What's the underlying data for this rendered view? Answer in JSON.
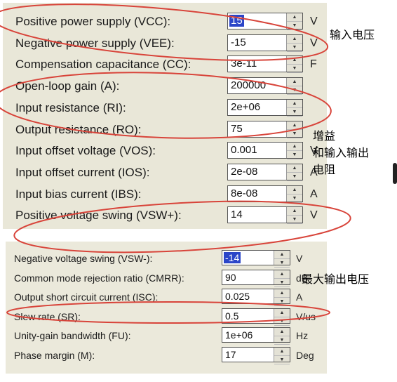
{
  "panel_top": {
    "rows": [
      {
        "label": "Positive power supply (VCC):",
        "value": "15",
        "unit": "V",
        "selected": true
      },
      {
        "label": "Negative power supply (VEE):",
        "value": "-15",
        "unit": "V"
      },
      {
        "label": "Compensation capacitance (CC):",
        "value": "3e-11",
        "unit": "F"
      },
      {
        "label": "Open-loop gain (A):",
        "value": "200000",
        "unit": ""
      },
      {
        "label": "Input resistance (RI):",
        "value": "2e+06",
        "unit": ""
      },
      {
        "label": "Output resistance (RO):",
        "value": "75",
        "unit": ""
      },
      {
        "label": "Input offset voltage (VOS):",
        "value": "0.001",
        "unit": "V"
      },
      {
        "label": "Input offset current (IOS):",
        "value": "2e-08",
        "unit": "A"
      },
      {
        "label": "Input bias current (IBS):",
        "value": "8e-08",
        "unit": "A"
      },
      {
        "label": "Positive voltage swing (VSW+):",
        "value": "14",
        "unit": "V"
      }
    ]
  },
  "panel_bottom": {
    "rows": [
      {
        "label": "Negative voltage swing (VSW-):",
        "value": "-14",
        "unit": "V",
        "selected": true
      },
      {
        "label": "Common mode rejection ratio (CMRR):",
        "value": "90",
        "unit": "dB"
      },
      {
        "label": "Output short circuit current (ISC):",
        "value": "0.025",
        "unit": "A"
      },
      {
        "label": "Slew rate (SR):",
        "value": "0.5",
        "unit": "V/us"
      },
      {
        "label": "Unity-gain bandwidth (FU):",
        "value": "1e+06",
        "unit": "Hz"
      },
      {
        "label": "Phase margin (M):",
        "value": "17",
        "unit": "Deg"
      }
    ]
  },
  "annotations": {
    "input_voltage": "输入电压",
    "gain_line1": "增益",
    "gain_line2": "和输入输出",
    "gain_line3": "电阻",
    "max_output": "最大输出电压"
  },
  "colors": {
    "annotation_ellipse": "#d8443a",
    "panel_bg": "#e9e7d8",
    "selection": "#2b45c8"
  }
}
